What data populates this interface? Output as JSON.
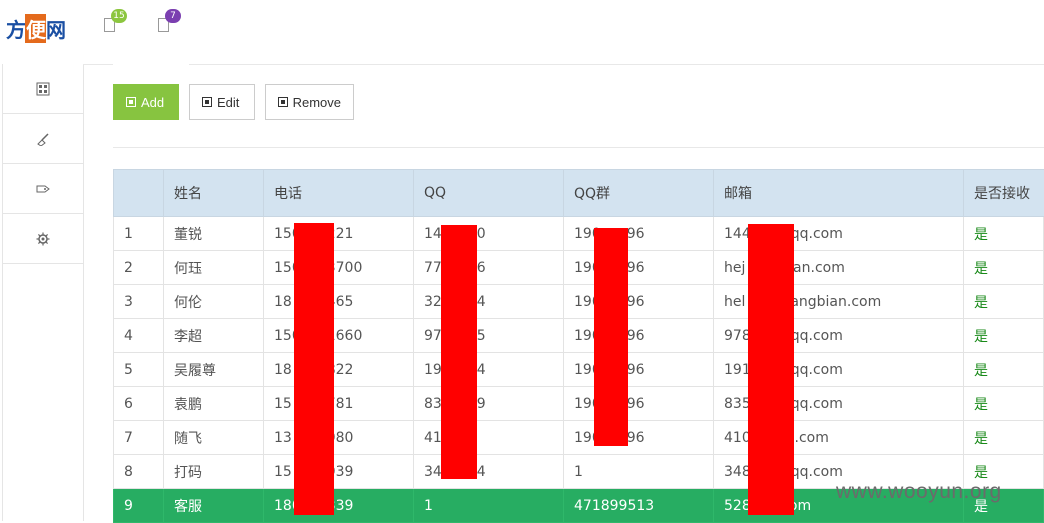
{
  "brand": {
    "logo_left": "方",
    "logo_mid": "便",
    "logo_right": "网"
  },
  "notifications": [
    {
      "icon": "document-icon",
      "count": "15",
      "color": "#8cc63f"
    },
    {
      "icon": "document-icon",
      "count": "7",
      "color": "#7b3fb0"
    }
  ],
  "sidebar": {
    "items": [
      {
        "icon": "grid-icon"
      },
      {
        "icon": "brush-icon"
      },
      {
        "icon": "tag-icon"
      },
      {
        "icon": "gear-icon"
      }
    ]
  },
  "toolbar": {
    "add_label": "Add",
    "edit_label": "Edit",
    "remove_label": "Remove"
  },
  "table": {
    "headers": [
      "",
      "姓名",
      "电话",
      "QQ",
      "QQ群",
      "邮箱",
      "是否接收"
    ],
    "rows": [
      [
        "1",
        "董锐",
        "150",
        "221",
        "14",
        "50",
        "190",
        "96",
        "144",
        "@qq.com",
        "是"
      ],
      [
        "2",
        "何珏",
        "150",
        "3700",
        "77",
        "66",
        "190",
        "96",
        "hej",
        "gbian.com",
        "是"
      ],
      [
        "3",
        "何伦",
        "18",
        "2465",
        "32",
        "54",
        "190",
        "96",
        "hel",
        "@fangbian.com",
        "是"
      ],
      [
        "4",
        "李超",
        "150",
        "1660",
        "97",
        "55",
        "190",
        "96",
        "978",
        "@qq.com",
        "是"
      ],
      [
        "5",
        "吴履尊",
        "18",
        "3822",
        "19",
        "94",
        "190",
        "96",
        "191",
        "@qq.com",
        "是"
      ],
      [
        "6",
        "袁鹏",
        "15",
        "4781",
        "83",
        "39",
        "190",
        "96",
        "835",
        "@qq.com",
        "是"
      ],
      [
        "7",
        "随飞",
        "13",
        "1980",
        "41",
        "",
        "190",
        "96",
        "410",
        "qq.com",
        "是"
      ],
      [
        "8",
        "打码",
        "15",
        "8939",
        "34",
        "64",
        "1",
        "",
        "348",
        "@qq.com",
        "是"
      ],
      [
        "9",
        "客服",
        "180",
        "339",
        "1",
        "",
        "471899513",
        "",
        "528",
        ".com",
        "是"
      ]
    ]
  },
  "watermark": "www.wooyun.org",
  "colors": {
    "add": "#87c440",
    "selected_row": "#27ad62",
    "header_bg": "#d3e3f0",
    "redaction": "#ff0000"
  }
}
